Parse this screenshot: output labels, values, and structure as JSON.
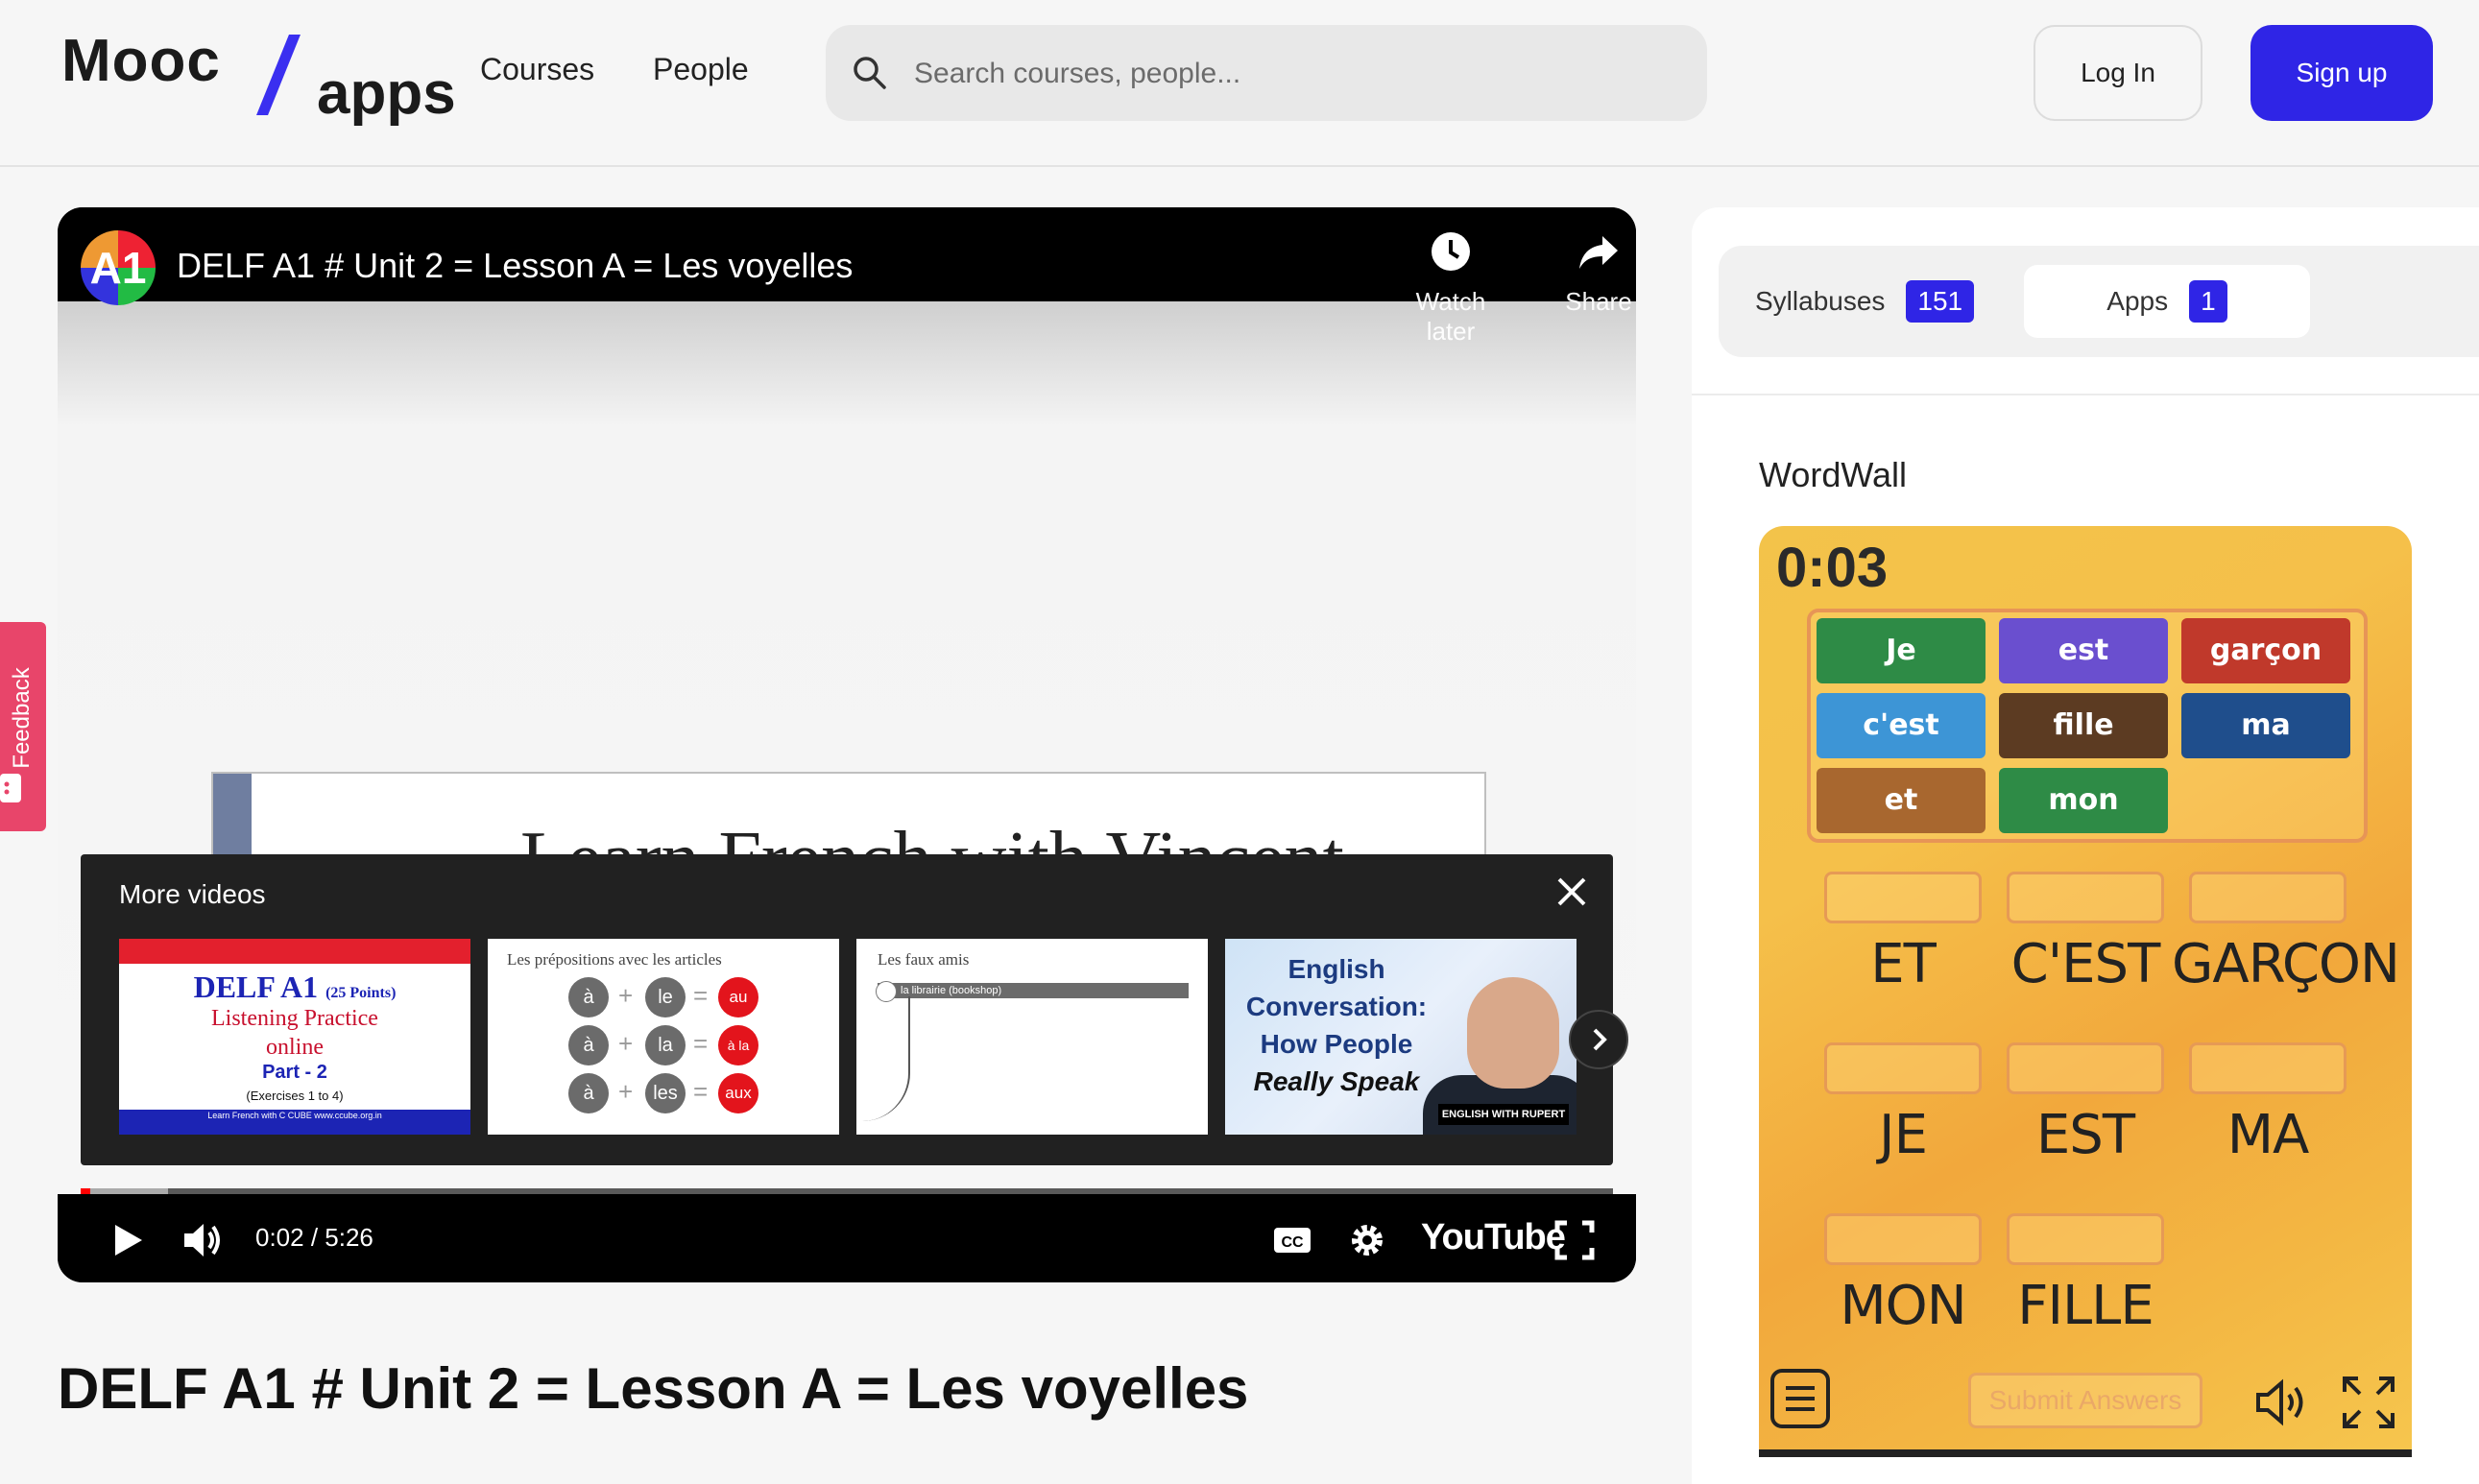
{
  "header": {
    "logo_mooc": "Mooc",
    "logo_apps": "apps",
    "nav": [
      "Courses",
      "People"
    ],
    "search_placeholder": "Search courses, people...",
    "login_label": "Log In",
    "signup_label": "Sign up",
    "accent_color": "#2f25e6"
  },
  "feedback": {
    "label": "Feedback",
    "color": "#e8456a"
  },
  "video": {
    "channel_avatar_text": "A1",
    "title": "DELF A1 # Unit 2 = Lesson A = Les voyelles",
    "watch_later_label": "Watch later",
    "share_label": "Share",
    "slide_title": "Learn French with Vincent",
    "more_videos_label": "More videos",
    "thumbs": {
      "t1": {
        "title": "DELF A1",
        "points": "(25 Points)",
        "line2": "Listening Practice",
        "line3": "online",
        "part": "Part - 2",
        "exercises": "(Exercises 1 to 4)",
        "footer": "Learn French with C CUBE www.ccube.org.in"
      },
      "t2": {
        "header": "Les prépositions avec les articles",
        "rows": [
          {
            "a": "à",
            "b": "le",
            "c": "au"
          },
          {
            "a": "à",
            "b": "la",
            "c": "à la"
          },
          {
            "a": "à",
            "b": "les",
            "c": "aux"
          }
        ]
      },
      "t3": {
        "header": "Les faux amis",
        "strip": "la librairie (bookshop)"
      },
      "t4": {
        "line1": "English",
        "line2": "Conversation:",
        "line3": "How People",
        "line4": "Really Speak",
        "tag": "ENGLISH WITH RUPERT"
      }
    },
    "time": "0:02 / 5:26",
    "progress_played": 0.006,
    "progress_buffered": 0.057,
    "youtube_label": "YouTube",
    "lesson_title": "DELF A1 # Unit 2 = Lesson A = Les voyelles"
  },
  "sidebar": {
    "tabs": [
      {
        "label": "Syllabuses",
        "count": "151"
      },
      {
        "label": "Apps",
        "count": "1"
      }
    ],
    "section_title": "WordWall"
  },
  "wordwall": {
    "timer": "0:03",
    "tiles": [
      {
        "text": "Je",
        "color": "#2e8b46"
      },
      {
        "text": "est",
        "color": "#6a4fcf"
      },
      {
        "text": "garçon",
        "color": "#c0392b"
      },
      {
        "text": "c'est",
        "color": "#3d95d6"
      },
      {
        "text": "fille",
        "color": "#5c3b22"
      },
      {
        "text": "ma",
        "color": "#1f4e8c"
      },
      {
        "text": "et",
        "color": "#a8672f"
      },
      {
        "text": "mon",
        "color": "#2e8b46"
      }
    ],
    "targets": [
      "ET",
      "C'EST",
      "GARÇON",
      "JE",
      "EST",
      "MA",
      "MON",
      "FILLE"
    ],
    "submit_label": "Submit Answers"
  }
}
